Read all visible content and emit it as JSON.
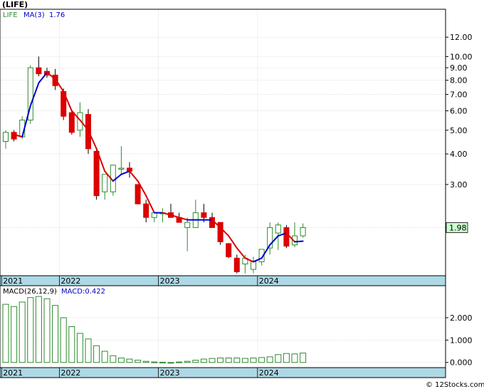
{
  "title": "(LIFE)",
  "footer": "© 12Stocks.com",
  "colors": {
    "up": "#2e8b2e",
    "down": "#dd0000",
    "ma_up": "#0000cc",
    "ma_down": "#dd0000",
    "axis_band": "#add8e6",
    "last_price_box": "#ccffcc",
    "macd_bar": "#2e8b2e"
  },
  "chart_data": [
    {
      "type": "candlestick",
      "scale": "log",
      "ylim": [
        1.28,
        15.5
      ],
      "legend": {
        "symbol": "LIFE",
        "ma_label": "MA(3)",
        "ma_value": "1.76"
      },
      "last_price_label": "1.98",
      "y_ticks": [
        {
          "value": 12,
          "label": "12.00"
        },
        {
          "value": 10,
          "label": "10.00"
        },
        {
          "value": 9,
          "label": "9.00"
        },
        {
          "value": 8,
          "label": "8.00"
        },
        {
          "value": 7,
          "label": "7.00"
        },
        {
          "value": 6,
          "label": "6.00"
        },
        {
          "value": 5,
          "label": "5.00"
        },
        {
          "value": 4,
          "label": "4.00"
        },
        {
          "value": 3,
          "label": "3.00"
        },
        {
          "value": 2,
          "label": "2.00"
        }
      ],
      "x_labels": [
        {
          "index": 0,
          "label": "2021"
        },
        {
          "index": 7,
          "label": "2022"
        },
        {
          "index": 19,
          "label": "2023"
        },
        {
          "index": 31,
          "label": "2024"
        }
      ],
      "candles": [
        {
          "o": 4.5,
          "h": 5.0,
          "l": 4.2,
          "c": 4.9
        },
        {
          "o": 4.9,
          "h": 5.0,
          "l": 4.5,
          "c": 4.6
        },
        {
          "o": 4.7,
          "h": 5.7,
          "l": 4.6,
          "c": 5.5
        },
        {
          "o": 5.5,
          "h": 9.2,
          "l": 5.3,
          "c": 9.0
        },
        {
          "o": 9.0,
          "h": 10.0,
          "l": 8.3,
          "c": 8.5
        },
        {
          "o": 8.7,
          "h": 9.0,
          "l": 8.2,
          "c": 8.4
        },
        {
          "o": 8.4,
          "h": 8.9,
          "l": 7.3,
          "c": 7.6
        },
        {
          "o": 7.2,
          "h": 7.4,
          "l": 5.5,
          "c": 5.7
        },
        {
          "o": 5.9,
          "h": 6.0,
          "l": 4.8,
          "c": 4.9
        },
        {
          "o": 5.0,
          "h": 6.5,
          "l": 4.7,
          "c": 5.9
        },
        {
          "o": 5.8,
          "h": 6.1,
          "l": 4.0,
          "c": 4.2
        },
        {
          "o": 4.1,
          "h": 4.2,
          "l": 2.6,
          "c": 2.7
        },
        {
          "o": 2.8,
          "h": 3.3,
          "l": 2.6,
          "c": 3.3
        },
        {
          "o": 2.8,
          "h": 3.6,
          "l": 2.7,
          "c": 3.6
        },
        {
          "o": 3.5,
          "h": 4.3,
          "l": 3.3,
          "c": 3.5
        },
        {
          "o": 3.5,
          "h": 3.7,
          "l": 3.2,
          "c": 3.4
        },
        {
          "o": 3.0,
          "h": 3.0,
          "l": 2.5,
          "c": 2.5
        },
        {
          "o": 2.5,
          "h": 2.6,
          "l": 2.1,
          "c": 2.2
        },
        {
          "o": 2.2,
          "h": 2.3,
          "l": 2.1,
          "c": 2.3
        },
        {
          "o": 2.3,
          "h": 2.4,
          "l": 2.1,
          "c": 2.3
        },
        {
          "o": 2.3,
          "h": 2.5,
          "l": 2.2,
          "c": 2.2
        },
        {
          "o": 2.2,
          "h": 2.3,
          "l": 2.1,
          "c": 2.1
        },
        {
          "o": 2.0,
          "h": 2.2,
          "l": 1.6,
          "c": 2.1
        },
        {
          "o": 2.0,
          "h": 2.6,
          "l": 2.0,
          "c": 2.3
        },
        {
          "o": 2.3,
          "h": 2.5,
          "l": 2.1,
          "c": 2.2
        },
        {
          "o": 2.2,
          "h": 2.3,
          "l": 2.0,
          "c": 2.0
        },
        {
          "o": 2.1,
          "h": 2.1,
          "l": 1.7,
          "c": 1.75
        },
        {
          "o": 1.72,
          "h": 1.73,
          "l": 1.5,
          "c": 1.52
        },
        {
          "o": 1.5,
          "h": 1.55,
          "l": 1.3,
          "c": 1.32
        },
        {
          "o": 1.42,
          "h": 1.55,
          "l": 1.3,
          "c": 1.5
        },
        {
          "o": 1.35,
          "h": 1.52,
          "l": 1.3,
          "c": 1.45
        },
        {
          "o": 1.45,
          "h": 1.63,
          "l": 1.4,
          "c": 1.63
        },
        {
          "o": 1.65,
          "h": 2.1,
          "l": 1.55,
          "c": 2.0
        },
        {
          "o": 1.9,
          "h": 2.1,
          "l": 1.62,
          "c": 2.05
        },
        {
          "o": 2.0,
          "h": 2.05,
          "l": 1.65,
          "c": 1.68
        },
        {
          "o": 1.7,
          "h": 2.1,
          "l": 1.66,
          "c": 1.85
        },
        {
          "o": 1.85,
          "h": 2.08,
          "l": 1.82,
          "c": 2.0
        }
      ],
      "ma": [
        null,
        4.8,
        4.7,
        6.3,
        7.8,
        8.6,
        8.1,
        7.2,
        6.0,
        5.5,
        5.0,
        4.2,
        3.4,
        3.1,
        3.3,
        3.4,
        3.1,
        2.7,
        2.3,
        2.3,
        2.25,
        2.2,
        2.15,
        2.15,
        2.15,
        2.15,
        2.0,
        1.85,
        1.65,
        1.5,
        1.45,
        1.5,
        1.7,
        1.85,
        1.9,
        1.75,
        1.76
      ]
    },
    {
      "type": "bar",
      "legend": {
        "label": "MACD(26,12,9)",
        "value_label": "MACD:0.422"
      },
      "ylim": [
        -0.2,
        3.4
      ],
      "y_ticks": [
        {
          "value": 2.0,
          "label": "2.000"
        },
        {
          "value": 1.0,
          "label": "1.000"
        },
        {
          "value": 0.0,
          "label": "0.000"
        }
      ],
      "x_labels": [
        {
          "index": 0,
          "label": "2021"
        },
        {
          "index": 7,
          "label": "2022"
        },
        {
          "index": 19,
          "label": "2023"
        },
        {
          "index": 31,
          "label": "2024"
        }
      ],
      "values": [
        2.6,
        2.5,
        2.7,
        2.9,
        2.95,
        2.85,
        2.55,
        2.0,
        1.6,
        1.3,
        1.05,
        0.75,
        0.5,
        0.3,
        0.2,
        0.15,
        0.1,
        0.05,
        0.02,
        0.01,
        0.0,
        0.02,
        0.05,
        0.1,
        0.15,
        0.18,
        0.2,
        0.2,
        0.2,
        0.18,
        0.2,
        0.22,
        0.25,
        0.35,
        0.4,
        0.38,
        0.42
      ]
    }
  ]
}
